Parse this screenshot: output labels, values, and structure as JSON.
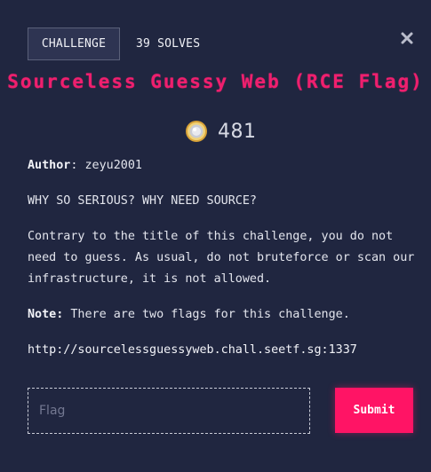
{
  "header": {
    "tab_label": "CHALLENGE",
    "solves_label": "39 SOLVES"
  },
  "challenge": {
    "title": "Sourceless Guessy Web (RCE Flag)",
    "points": "481",
    "author_label": "Author",
    "author_sep": ":",
    "author": "zeyu2001",
    "tagline": "WHY SO SERIOUS? WHY NEED SOURCE?",
    "body": "Contrary to the title of this challenge, you do not need to guess. As usual, do not bruteforce or scan our infrastructure, it is not allowed.",
    "note_label": "Note:",
    "note": "There are two flags for this challenge.",
    "url": "http://sourcelessguessyweb.chall.seetf.sg:1337"
  },
  "form": {
    "flag_placeholder": "Flag",
    "flag_value": "",
    "submit_label": "Submit"
  },
  "icons": {
    "close": "close-icon",
    "coin": "coin-icon"
  },
  "colors": {
    "background": "#202640",
    "accent": "#ef1f6e",
    "submit": "#ff1465"
  }
}
